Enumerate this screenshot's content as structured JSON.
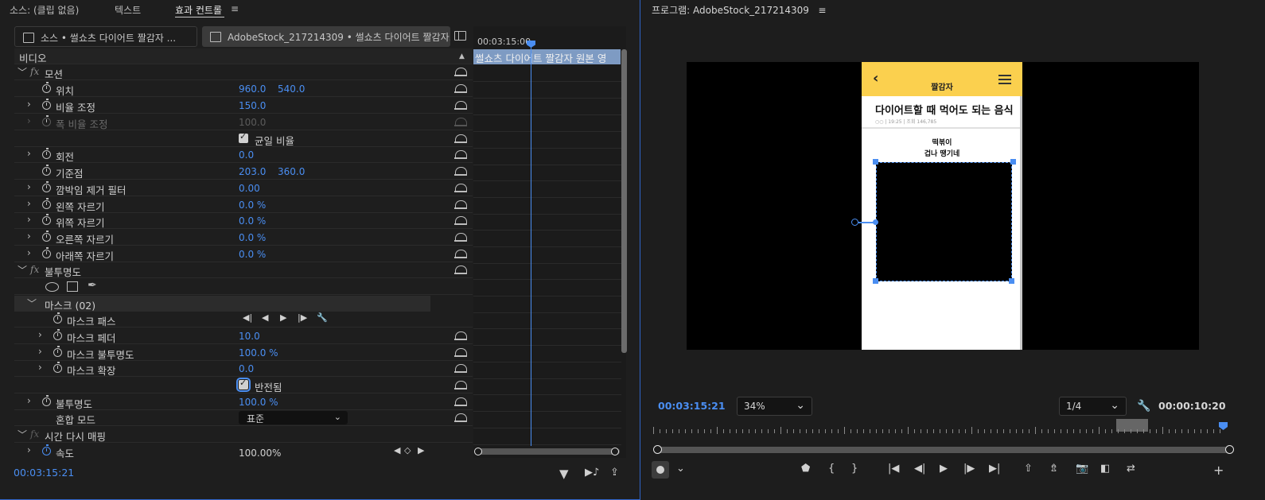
{
  "left": {
    "tabs": [
      "소스: (클립 없음)",
      "텍스트",
      "효과 컨트롤"
    ],
    "menu_glyph": "≡",
    "source_clip": "소스 • 썰쇼츠 다이어트 짤감자 ...",
    "sequence_clip": "AdobeStock_217214309 • 썰쇼츠 다이어트 짤감자...",
    "timeline_time": "00:03:15:00",
    "timeline_clip": "썰쇼츠 다이어트 짤감자 원본 영",
    "footer_time": "00:03:15:21",
    "rows": {
      "video": "비디오",
      "motion": "모션",
      "position": "위치",
      "position_x": "960.0",
      "position_y": "540.0",
      "scale": "비율 조정",
      "scale_v": "150.0",
      "scale_w": "폭 비율 조정",
      "scale_w_v": "100.0",
      "uniform": "균일 비율",
      "rotation": "회전",
      "rotation_v": "0.0",
      "anchor": "기준점",
      "anchor_x": "203.0",
      "anchor_y": "360.0",
      "flicker": "깜박임 제거 필터",
      "flicker_v": "0.00",
      "crop_left": "왼쪽 자르기",
      "crop_left_v": "0.0 %",
      "crop_top": "위쪽 자르기",
      "crop_top_v": "0.0 %",
      "crop_right": "오른쪽 자르기",
      "crop_right_v": "0.0 %",
      "crop_bottom": "아래쪽 자르기",
      "crop_bottom_v": "0.0 %",
      "opacity_group": "불투명도",
      "mask": "마스크 (02)",
      "mask_path": "마스크 패스",
      "mask_feather": "마스크 페더",
      "mask_feather_v": "10.0",
      "mask_opacity": "마스크 불투명도",
      "mask_opacity_v": "100.0 %",
      "mask_expand": "마스크 확장",
      "mask_expand_v": "0.0",
      "inverted": "반전됨",
      "opacity": "불투명도",
      "opacity_v": "100.0 %",
      "blend": "혼합 모드",
      "blend_v": "표준",
      "time_remap": "시간 다시 매핑",
      "speed": "속도",
      "speed_v": "100.00%"
    }
  },
  "right": {
    "title": "프로그램: AdobeStock_217214309",
    "menu_glyph": "≡",
    "phone": {
      "header": "짤감자",
      "article_title": "다이어트할 때 먹어도 되는 음식",
      "meta": "○○ | 19:25 | 조회 146,785",
      "caption1": "떡볶이",
      "caption2": "겁나 땡기네"
    },
    "current_time": "00:03:15:21",
    "zoom": "34%",
    "resolution": "1/4",
    "duration": "00:00:10:20"
  },
  "colors": {
    "accent": "#4a8ef2",
    "phone_header": "#fbd04e"
  }
}
